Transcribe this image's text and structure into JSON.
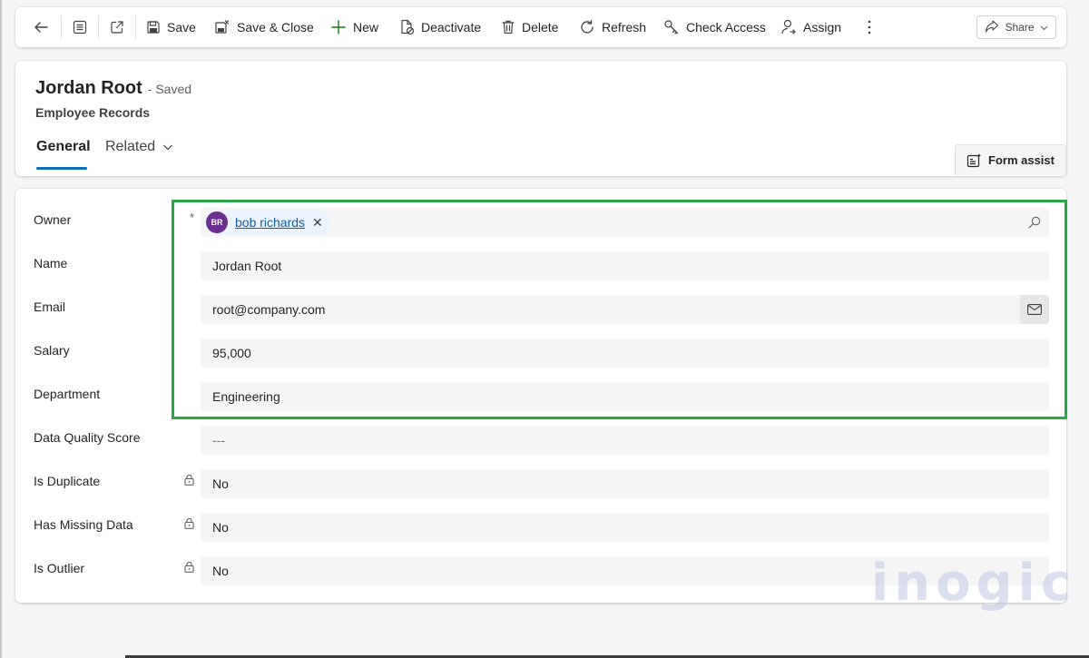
{
  "commandbar": {
    "save_label": "Save",
    "save_close_label": "Save & Close",
    "new_label": "New",
    "deactivate_label": "Deactivate",
    "delete_label": "Delete",
    "refresh_label": "Refresh",
    "check_access_label": "Check Access",
    "assign_label": "Assign",
    "share_label": "Share"
  },
  "header": {
    "title": "Jordan Root",
    "status": "- Saved",
    "entity": "Employee Records",
    "tabs": [
      {
        "label": "General",
        "selected": true
      },
      {
        "label": "Related",
        "selected": false
      }
    ],
    "form_assist_label": "Form assist"
  },
  "form": {
    "fields": [
      {
        "label": "Owner",
        "required": "*",
        "owner_initials": "BR",
        "owner_name": "bob richards"
      },
      {
        "label": "Name",
        "value": "Jordan Root"
      },
      {
        "label": "Email",
        "value": "root@company.com"
      },
      {
        "label": "Salary",
        "value": "95,000"
      },
      {
        "label": "Department",
        "value": "Engineering"
      },
      {
        "label": "Data Quality Score",
        "value": "---"
      },
      {
        "label": "Is Duplicate",
        "value": "No",
        "locked": true
      },
      {
        "label": "Has Missing Data",
        "value": "No",
        "locked": true
      },
      {
        "label": "Is Outlier",
        "value": "No",
        "locked": true
      }
    ]
  },
  "icons": {
    "back": "back-arrow-icon",
    "form_view": "form-view-icon",
    "open_new_window": "open-in-new-window-icon",
    "mail": "mail-icon",
    "search": "search-icon",
    "lock": "lock-icon"
  },
  "colors": {
    "accent": "#0f6cbd",
    "highlight": "#27a845",
    "avatar": "#6b2f8f",
    "new_icon": "#107c10"
  },
  "watermark": "inogic"
}
